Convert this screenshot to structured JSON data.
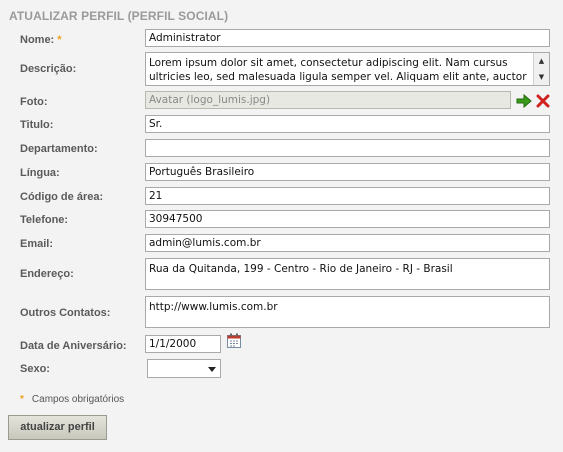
{
  "form": {
    "title": "ATUALIZAR PERFIL (PERFIL SOCIAL)",
    "fields": {
      "nome": {
        "label": "Nome:",
        "required_mark": "*",
        "value": "Administrator"
      },
      "descricao": {
        "label": "Descrição:",
        "value": "Lorem ipsum dolor sit amet, consectetur adipiscing elit. Nam cursus ultricies leo, sed malesuada ligula semper vel. Aliquam elit ante, auctor id bibendum ac,"
      },
      "foto": {
        "label": "Foto:",
        "value": "Avatar (logo_lumis.jpg)"
      },
      "titulo": {
        "label": "Titulo:",
        "value": "Sr."
      },
      "departamento": {
        "label": "Departamento:",
        "value": ""
      },
      "lingua": {
        "label": "Língua:",
        "value": "Português Brasileiro"
      },
      "codigo_area": {
        "label": "Código de área:",
        "value": "21"
      },
      "telefone": {
        "label": "Telefone:",
        "value": "30947500"
      },
      "email": {
        "label": "Email:",
        "value": "admin@lumis.com.br"
      },
      "endereco": {
        "label": "Endereço:",
        "value": "Rua da Quitanda, 199 - Centro - Rio de Janeiro - RJ - Brasil"
      },
      "outros_contatos": {
        "label": "Outros Contatos:",
        "value": "http://www.lumis.com.br"
      },
      "aniversario": {
        "label": "Data de Aniversário:",
        "value": "1/1/2000"
      },
      "sexo": {
        "label": "Sexo:",
        "value": ""
      }
    },
    "required_note": {
      "mark": "*",
      "text": "Campos obrigatórios"
    },
    "submit_label": "atualizar perfil"
  },
  "colors": {
    "required": "#f0a020",
    "select_arrow": "#3a9a1a",
    "clear_x": "#d02020",
    "background": "#f3f3f3"
  },
  "icons": [
    "arrow-right-icon",
    "clear-x-icon",
    "calendar-icon",
    "chevron-down-icon"
  ]
}
